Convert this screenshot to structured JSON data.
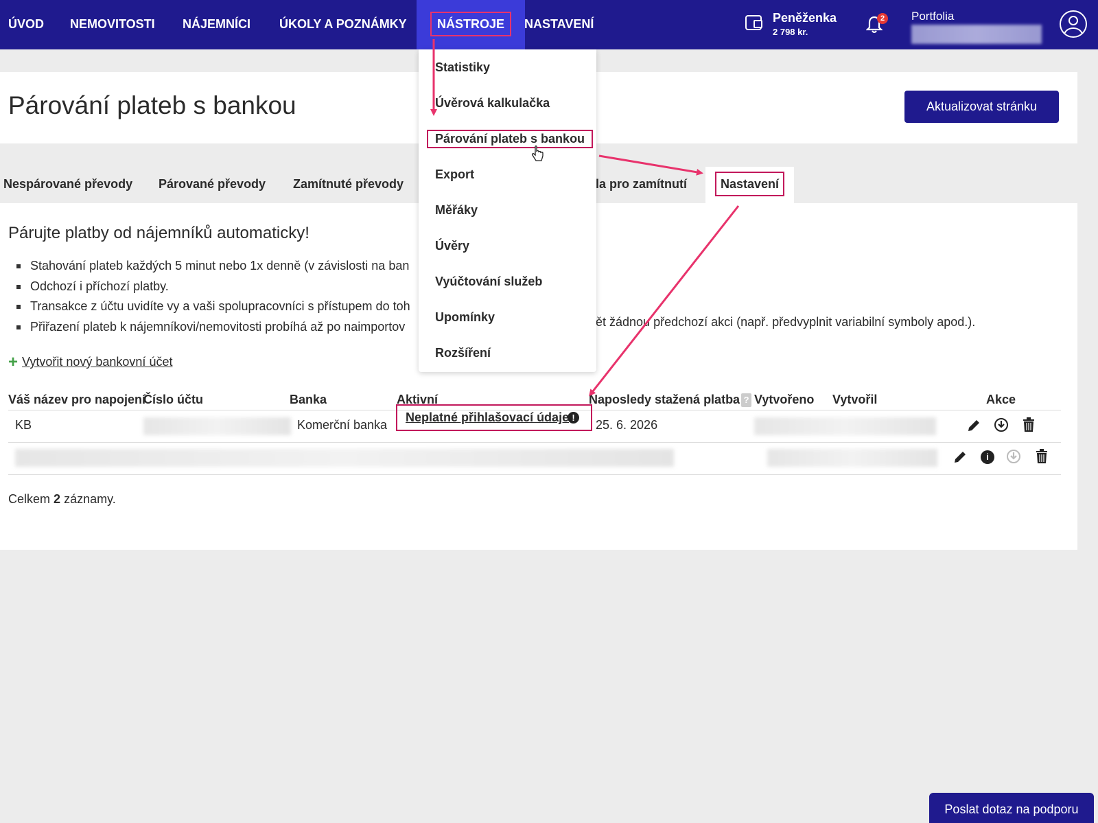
{
  "nav": {
    "items": [
      "ÚVOD",
      "NEMOVITOSTI",
      "NÁJEMNÍCI",
      "ÚKOLY A POZNÁMKY",
      "NÁSTROJE",
      "NASTAVENÍ"
    ],
    "active": "NÁSTROJE"
  },
  "wallet": {
    "label": "Peněženka",
    "amount": "2 798 kr."
  },
  "notifications": {
    "count": "2"
  },
  "portfolio": {
    "label": "Portfolia"
  },
  "header": {
    "title": "Párování plateb s bankou",
    "refresh_button": "Aktualizovat stránku"
  },
  "tabs": [
    "Nespárované převody",
    "Párované převody",
    "Zamítnuté převody",
    "Pravidla pro zamítnutí",
    "Nastavení"
  ],
  "tabs_visible": {
    "partial_4": "la pro zamítnutí"
  },
  "intro": {
    "title": "Párujte platby od nájemníků automaticky!",
    "features": [
      "Stahování plateb každých 5 minut nebo 1x denně (v závislosti na ban",
      "Odchozí i příchozí platby.",
      "Transakce z účtu uvidíte vy a vaši spolupracovníci s přístupem do toh",
      "Přiřazení plateb k nájemníkovi/nemovitosti probíhá až po naimportov"
    ],
    "feature4_tail": "ět žádnou předchozí akci (např. předvyplnit variabilní symboly apod.).",
    "create_link": "Vytvořit nový bankovní účet"
  },
  "table": {
    "headers": {
      "name": "Váš název pro napojení",
      "account": "Číslo účtu",
      "bank": "Banka",
      "active": "Aktivní",
      "last_payment": "Naposledy stažená platba",
      "created": "Vytvořeno",
      "created_by": "Vytvořil",
      "actions": "Akce"
    },
    "help_mark": "?",
    "rows": [
      {
        "name": "KB",
        "bank": "Komerční banka",
        "status": "Neplatné přihlašovací údaje",
        "last_payment": "25. 6. 2026"
      }
    ],
    "total_prefix": "Celkem",
    "total_count": "2",
    "total_suffix": "záznamy."
  },
  "dropdown": {
    "items": [
      "Statistiky",
      "Úvěrová kalkulačka",
      "Párování plateb s bankou",
      "Export",
      "Měřáky",
      "Úvěry",
      "Vyúčtování služeb",
      "Upomínky",
      "Rozšíření"
    ],
    "highlighted": "Párování plateb s bankou"
  },
  "support_button": "Poslat dotaz na podporu",
  "colors": {
    "nav_bg": "#1f1a8e",
    "nav_active": "#3b3bd9",
    "annotation": "#e8336c",
    "plus": "#43a047"
  }
}
